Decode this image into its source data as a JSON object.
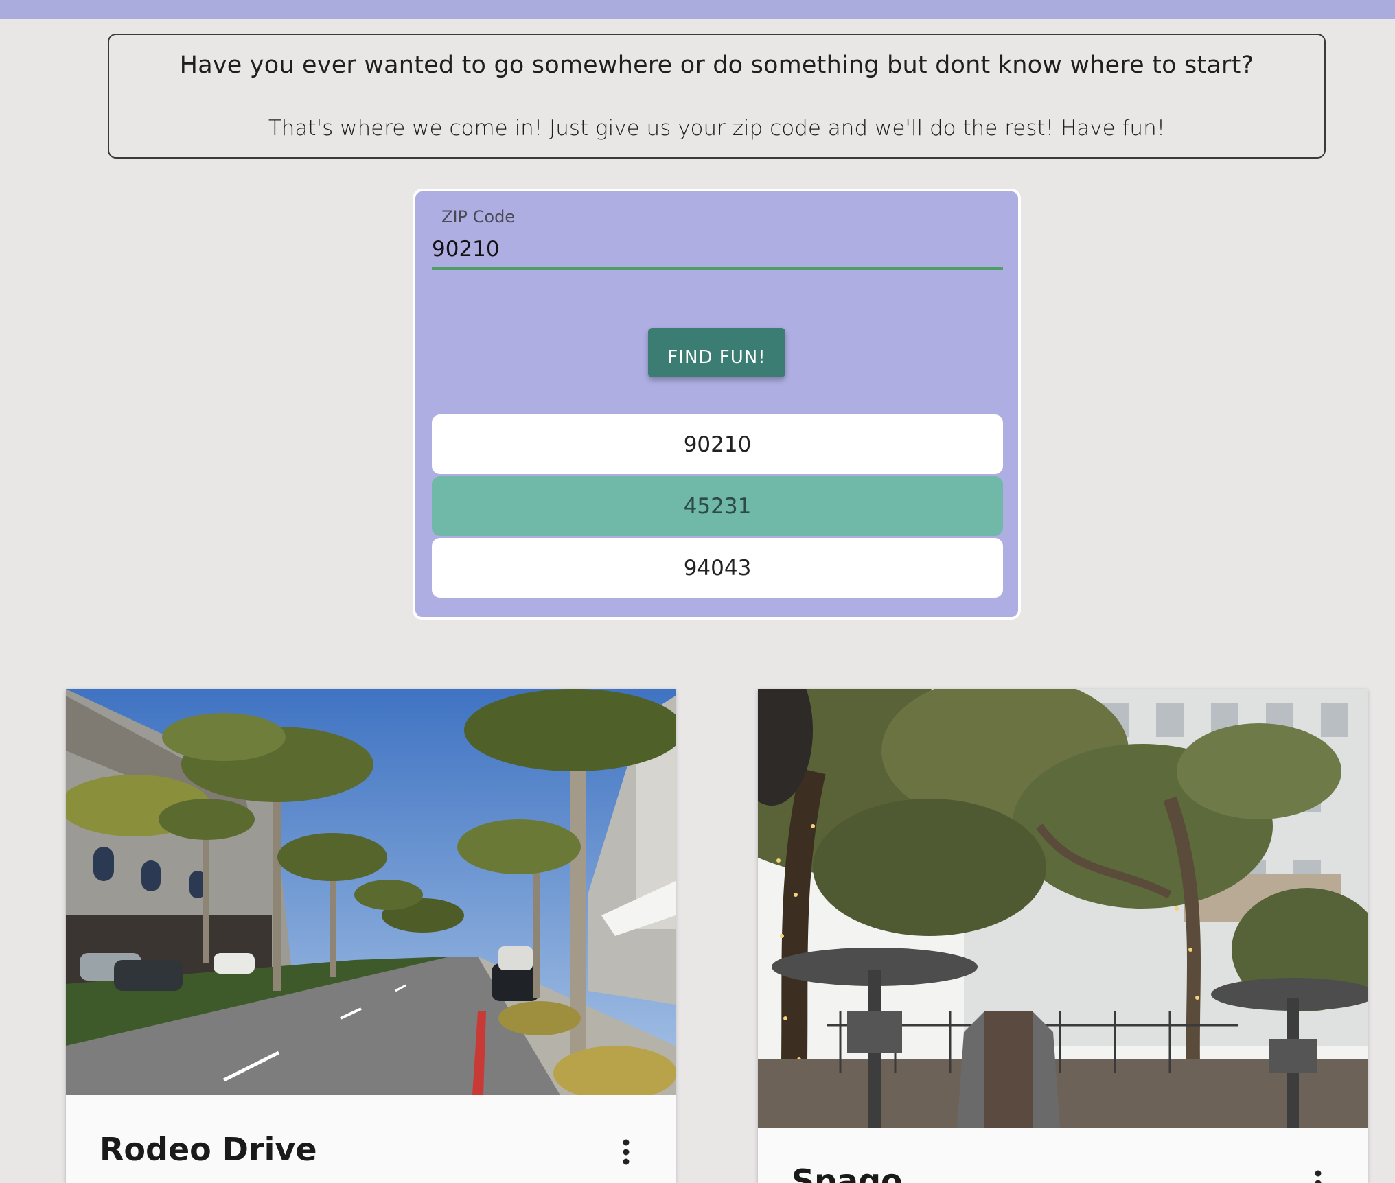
{
  "intro": {
    "headline": "Have you ever wanted to go somewhere or do something but dont know where to start?",
    "subtext": "That's where we come in! Just give us your zip code and we'll do the rest! Have fun!"
  },
  "search": {
    "label": "ZIP Code",
    "value": "90210",
    "button_label": "FIND FUN!",
    "suggestions": [
      {
        "zip": "90210",
        "highlighted": false
      },
      {
        "zip": "45231",
        "highlighted": true
      },
      {
        "zip": "94043",
        "highlighted": false
      }
    ]
  },
  "cards": [
    {
      "title": "Rodeo Drive",
      "menu_icon": "more-vert-icon"
    },
    {
      "title": "Spago",
      "menu_icon": "more-vert-icon"
    }
  ],
  "colors": {
    "top_bar": "#a9acdc",
    "panel": "#aeaee3",
    "button": "#3b7d72",
    "highlight": "#70b8a8",
    "input_underline": "#4e9e66"
  }
}
